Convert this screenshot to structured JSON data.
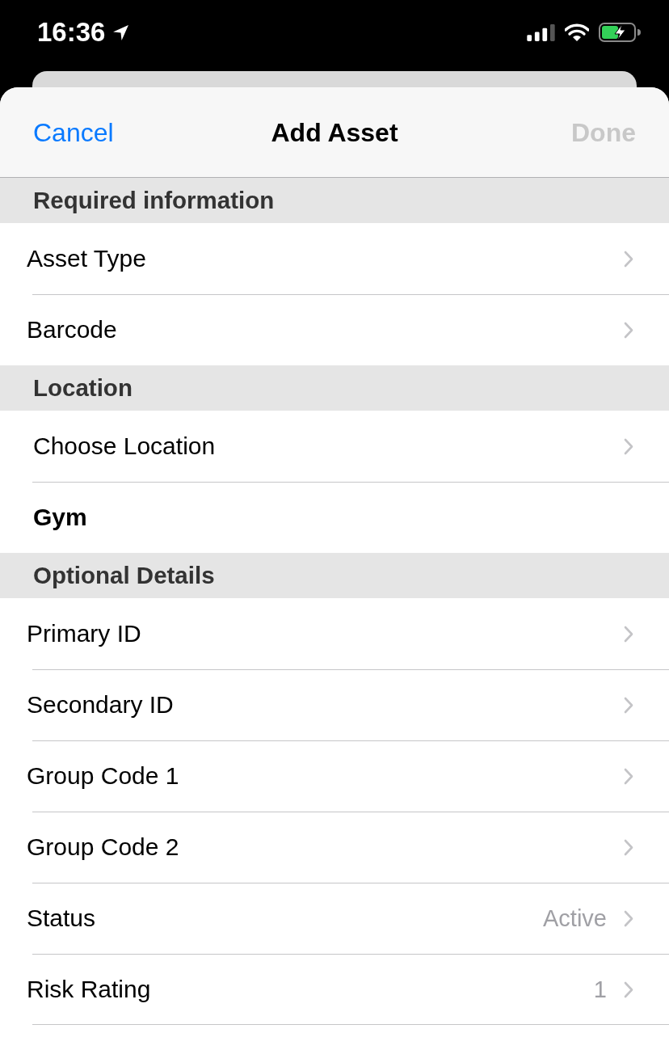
{
  "status_bar": {
    "time": "16:36"
  },
  "nav_bar": {
    "cancel": "Cancel",
    "title": "Add Asset",
    "done": {
      "label": "Done",
      "disabled": true
    }
  },
  "sections": [
    {
      "header": "Required information",
      "rows": [
        {
          "kind": "link",
          "label": "Asset Type"
        },
        {
          "kind": "link",
          "label": "Barcode"
        }
      ]
    },
    {
      "header": "Location",
      "rows": [
        {
          "kind": "link",
          "label": "Choose Location"
        },
        {
          "kind": "info",
          "label": "Gym"
        }
      ]
    },
    {
      "header": "Optional Details",
      "rows": [
        {
          "kind": "link",
          "label": "Primary ID"
        },
        {
          "kind": "link",
          "label": "Secondary ID"
        },
        {
          "kind": "link",
          "label": "Group Code 1"
        },
        {
          "kind": "link",
          "label": "Group Code 2"
        },
        {
          "kind": "link",
          "label": "Status",
          "value": "Active"
        },
        {
          "kind": "link",
          "label": "Risk Rating",
          "value": "1"
        }
      ]
    }
  ]
}
